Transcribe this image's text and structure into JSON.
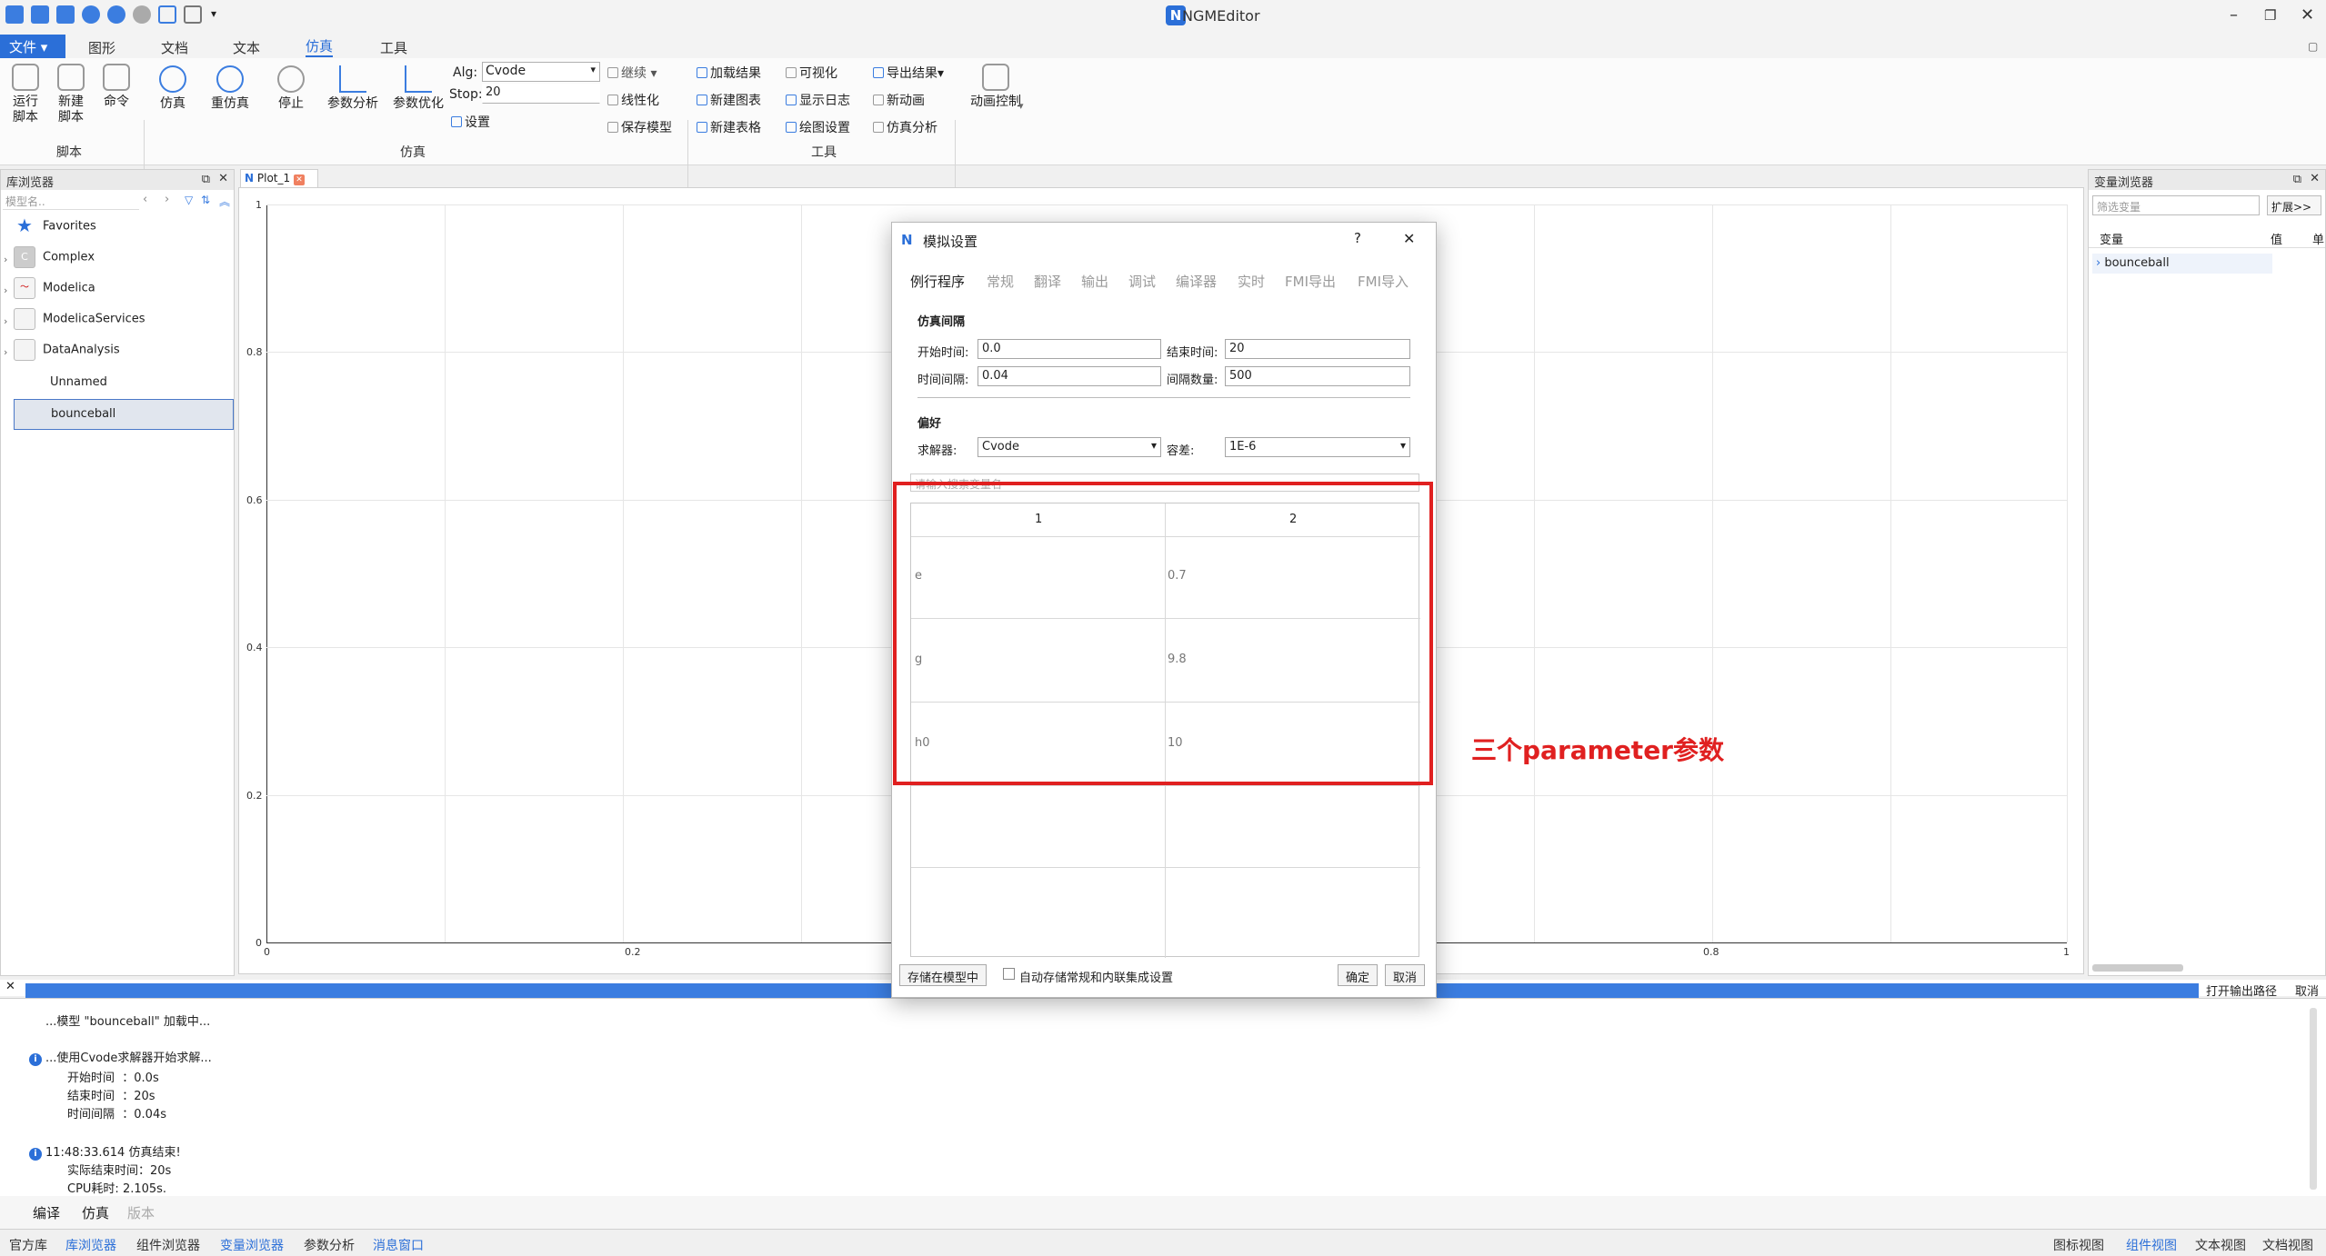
{
  "window": {
    "title": "NGMEditor"
  },
  "menu": {
    "file": "文件",
    "tabs": [
      "图形",
      "文档",
      "文本",
      "仿真",
      "工具"
    ]
  },
  "ribbon": {
    "script_group": {
      "run": "运行\n脚本",
      "new": "新建\n脚本",
      "cmd": "命令",
      "label": "脚本"
    },
    "sim_group": {
      "simulate": "仿真",
      "resim": "重仿真",
      "stop": "停止",
      "param_analysis": "参数分析",
      "param_opt": "参数优化",
      "label": "仿真",
      "alg_label": "Alg:",
      "alg_value": "Cvode",
      "stop_label": "Stop:",
      "stop_value": "20",
      "settings": "设置",
      "continue": "继续",
      "linearize": "线性化",
      "save_model": "保存模型"
    },
    "tools_group": {
      "load_result": "加载结果",
      "new_chart": "新建图表",
      "new_table": "新建表格",
      "visualize": "可视化",
      "show_log": "显示日志",
      "plot_settings": "绘图设置",
      "export_result": "导出结果",
      "new_anim": "新动画",
      "sim_analysis": "仿真分析",
      "label": "工具"
    },
    "anim": {
      "label": "动画控制"
    }
  },
  "library": {
    "title": "库浏览器",
    "search_placeholder": "模型名..",
    "items": [
      "Favorites",
      "Complex",
      "Modelica",
      "ModelicaServices",
      "DataAnalysis",
      "Unnamed",
      "bounceball"
    ]
  },
  "plot": {
    "tab": "Plot_1",
    "y_ticks": [
      "1",
      "0.8",
      "0.6",
      "0.4",
      "0.2",
      "0"
    ],
    "x_ticks": [
      "0",
      "0.2",
      "0.8",
      "1"
    ]
  },
  "variables": {
    "title": "变量浏览器",
    "filter_placeholder": "筛选变量",
    "expand": "扩展>>",
    "col_var": "变量",
    "col_val": "值",
    "col_unit": "单",
    "items": [
      "bounceball"
    ]
  },
  "dialog": {
    "title": "模拟设置",
    "help": "?",
    "close": "✕",
    "tabs": [
      "例行程序",
      "常规",
      "翻译",
      "输出",
      "调试",
      "编译器",
      "实时",
      "FMI导出",
      "FMI导入"
    ],
    "interval_section": "仿真间隔",
    "start_label": "开始时间:",
    "start_value": "0.0",
    "end_label": "结束时间:",
    "end_value": "20",
    "step_label": "时间间隔:",
    "step_value": "0.04",
    "count_label": "间隔数量:",
    "count_value": "500",
    "pref_section": "偏好",
    "solver_label": "求解器:",
    "solver_value": "Cvode",
    "tol_label": "容差:",
    "tol_value": "1E-6",
    "search_placeholder": "请输入搜索变量名",
    "table": {
      "headers": [
        "1",
        "2"
      ],
      "rows": [
        [
          "e",
          "0.7"
        ],
        [
          "g",
          "9.8"
        ],
        [
          "h0",
          "10"
        ]
      ]
    },
    "store_btn": "存储在模型中",
    "auto_store": "自动存储常规和内联集成设置",
    "ok": "确定",
    "cancel": "取消"
  },
  "annotation": "三个parameter参数",
  "log": {
    "open_path": "打开输出路径",
    "cancel": "取消",
    "lines": [
      "...模型 \"bounceball\" 加载中...",
      "...使用Cvode求解器开始求解...",
      "开始时间  ：0.0s",
      "结束时间  ：20s",
      "时间间隔  ：0.04s",
      "11:48:33.614 仿真结束!",
      "实际结束时间：20s",
      "CPU耗时: 2.105s."
    ],
    "tabs": [
      "编译",
      "仿真",
      "版本"
    ]
  },
  "statusbar": {
    "left": [
      "官方库",
      "库浏览器",
      "组件浏览器",
      "变量浏览器",
      "参数分析",
      "消息窗口"
    ],
    "right": [
      "图标视图",
      "组件视图",
      "文本视图",
      "文档视图"
    ]
  },
  "colors": {
    "accent": "#2b6fd8",
    "annotation": "#e02020"
  }
}
